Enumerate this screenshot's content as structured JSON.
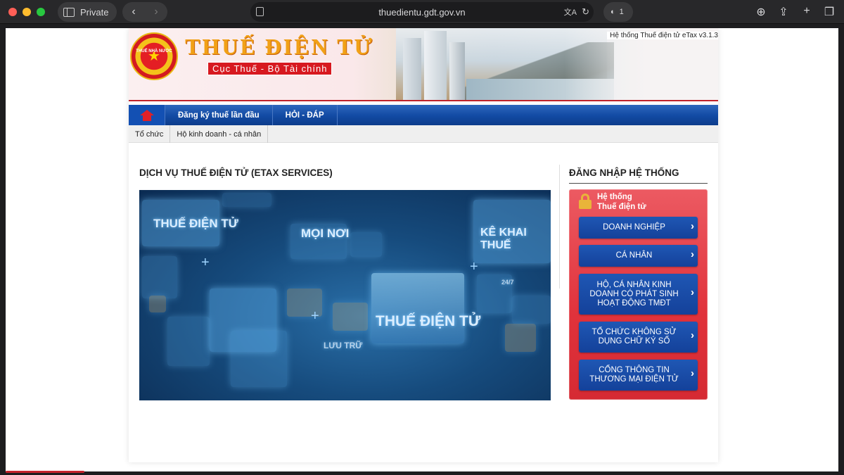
{
  "browser": {
    "private_label": "Private",
    "url": "thuedientu.gdt.gov.vn",
    "shield_count": "1"
  },
  "banner": {
    "title": "THUẾ ĐIỆN TỬ",
    "subtitle": "Cục Thuế - Bộ Tài chính",
    "emblem_text": "THUẾ NHÀ NƯỚC",
    "version": "Hệ thống Thuế điện tử eTax v3.1.3"
  },
  "nav": {
    "items": [
      "Đăng ký thuế lần đầu",
      "HỎI - ĐÁP"
    ]
  },
  "subnav": {
    "items": [
      "Tổ chức",
      "Hộ kinh doanh - cá nhân"
    ]
  },
  "main": {
    "section_title": "DỊCH VỤ THUẾ ĐIỆN TỬ (ETAX SERVICES)",
    "hero_labels": [
      "THUẾ ĐIỆN TỬ",
      "MỌI NƠI",
      "KÊ KHAI THUẾ",
      "THUẾ ĐIỆN TỬ",
      "LƯU TRỮ",
      "24/7"
    ]
  },
  "login": {
    "title": "ĐĂNG NHẬP HỆ THỐNG",
    "header_line1": "Hệ thống",
    "header_line2": "Thuế điện tử",
    "buttons": [
      "DOANH NGHIỆP",
      "CÁ NHÂN",
      "HỘ, CÁ NHÂN KINH DOANH CÓ PHÁT SINH HOẠT ĐỘNG TMĐT",
      "TỔ CHỨC KHÔNG SỬ DỤNG CHỮ KÝ SỐ",
      "CỔNG THÔNG TIN THƯƠNG MẠI ĐIỆN TỬ"
    ]
  },
  "colors": {
    "nav_blue": "#124aa3",
    "login_red": "#e0323b",
    "button_blue": "#1a4fa8",
    "brand_orange": "#f1a117"
  }
}
